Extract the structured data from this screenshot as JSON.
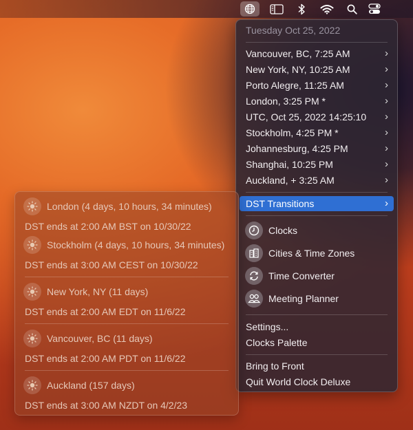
{
  "menubar": {
    "icons": [
      "globe-icon",
      "sidebar-icon",
      "bluetooth-icon",
      "wifi-icon",
      "search-icon",
      "control-center-icon"
    ]
  },
  "menu": {
    "date_header": "Tuesday Oct 25, 2022",
    "cities": [
      {
        "label": "Vancouver, BC, 7:25 AM"
      },
      {
        "label": "New York, NY, 10:25 AM"
      },
      {
        "label": "Porto Alegre, 11:25 AM"
      },
      {
        "label": "London, 3:25 PM *"
      },
      {
        "label": "UTC, Oct 25, 2022 14:25:10"
      },
      {
        "label": "Stockholm, 4:25 PM *"
      },
      {
        "label": "Johannesburg, 4:25 PM"
      },
      {
        "label": "Shanghai, 10:25 PM"
      },
      {
        "label": "Auckland, + 3:25 AM"
      }
    ],
    "dst_label": "DST Transitions",
    "tools": [
      {
        "label": "Clocks",
        "icon": "clock-icon"
      },
      {
        "label": "Cities & Time Zones",
        "icon": "buildings-icon"
      },
      {
        "label": "Time Converter",
        "icon": "convert-arrows-icon"
      },
      {
        "label": "Meeting Planner",
        "icon": "people-icon"
      }
    ],
    "settings_label": "Settings...",
    "palette_label": "Clocks Palette",
    "bring_front_label": "Bring to Front",
    "quit_label": "Quit World Clock Deluxe"
  },
  "dst_submenu": [
    {
      "city": "London (4 days, 10 hours, 34 minutes)",
      "note": "DST ends at 2:00 AM BST on 10/30/22"
    },
    {
      "city": "Stockholm (4 days, 10 hours, 34 minutes)",
      "note": "DST ends at 3:00 AM CEST on 10/30/22"
    },
    {
      "city": "New York, NY (11 days)",
      "note": "DST ends at 2:00 AM EDT on 11/6/22"
    },
    {
      "city": "Vancouver, BC (11 days)",
      "note": "DST ends at 2:00 AM PDT on 11/6/22"
    },
    {
      "city": "Auckland (157 days)",
      "note": "DST ends at 3:00 AM NZDT on 4/2/23"
    }
  ],
  "colors": {
    "highlight": "#2f6fd3"
  }
}
